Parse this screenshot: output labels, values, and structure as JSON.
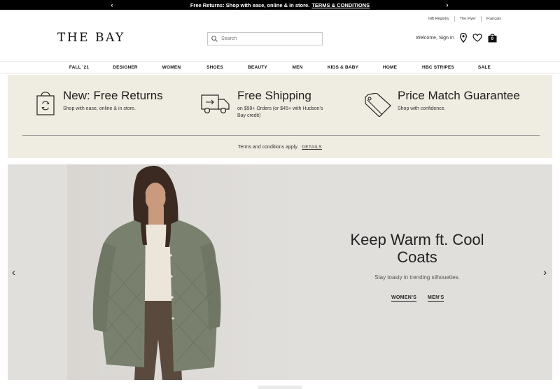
{
  "promo": {
    "text": "Free Returns: Shop with ease, online & in store.",
    "link": "TERMS & CONDITIONS",
    "prev": "‹",
    "next": "›"
  },
  "utility": [
    "Gift Registry",
    "The Flyer",
    "Français"
  ],
  "header": {
    "logo": "THE BAY",
    "search_placeholder": "Search",
    "welcome": "Welcome, Sign In",
    "bag_count": "0"
  },
  "nav": [
    "FALL '21",
    "DESIGNER",
    "WOMEN",
    "SHOES",
    "BEAUTY",
    "MEN",
    "KIDS & BABY",
    "HOME",
    "HBC STRIPES",
    "SALE"
  ],
  "benefits": [
    {
      "title": "New: Free Returns",
      "subtitle": "Shop with ease, online & in store.",
      "icon": "returns-bag-icon"
    },
    {
      "title": "Free Shipping",
      "subtitle": "on $99+ Orders (or $45+ with Hudson's Bay credit)",
      "icon": "truck-icon"
    },
    {
      "title": "Price Match Guarantee",
      "subtitle": "Shop with confidence.",
      "icon": "price-tag-icon"
    }
  ],
  "terms": {
    "text": "Terms and conditions apply.",
    "link": "DETAILS"
  },
  "hero": {
    "heading": "Keep Warm ft. Cool Coats",
    "subtitle": "Stay toasty in trending silhouettes.",
    "links": [
      "WOMEN'S",
      "MEN'S"
    ],
    "prev": "‹",
    "next": "›"
  },
  "colors": {
    "promo_bg": "#000000",
    "benefits_bg": "#efece1",
    "hero_bg": "#e1dfdc",
    "coat": "#79816e"
  }
}
